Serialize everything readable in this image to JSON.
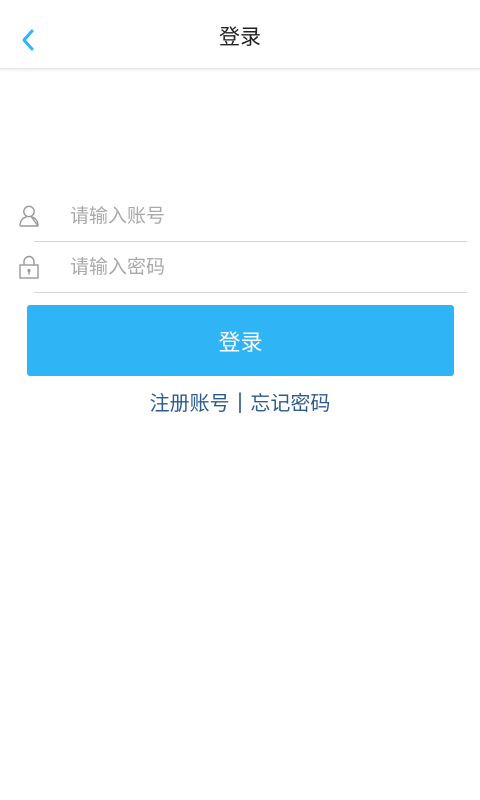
{
  "header": {
    "title": "登录",
    "back_icon": "chevron-left-icon",
    "back_color": "#2fb4f6"
  },
  "form": {
    "account": {
      "placeholder": "请输入账号",
      "value": "",
      "icon": "user-icon"
    },
    "password": {
      "placeholder": "请输入密码",
      "value": "",
      "icon": "lock-icon"
    }
  },
  "login_button": {
    "label": "登录",
    "color": "#2fb4f6"
  },
  "links": {
    "register": "注册账号",
    "separator": "|",
    "forgot": "忘记密码",
    "color": "#2e5b8f"
  }
}
